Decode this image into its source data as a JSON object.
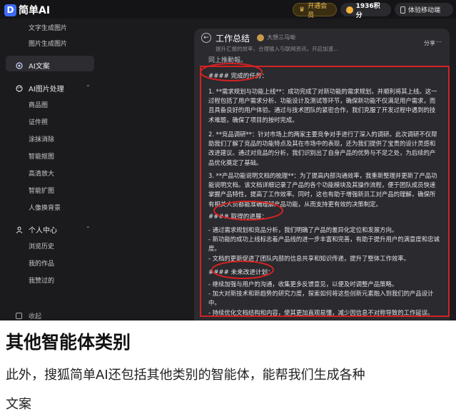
{
  "topbar": {
    "logo_mark": "D",
    "logo_text": "简单AI",
    "vip_label": "开通会员",
    "points_label": "1936积分",
    "mobile_label": "体验移动端"
  },
  "sidebar": {
    "items_top": [
      "文字生成图片",
      "图片生成图片"
    ],
    "active_label": "AI文案",
    "section_image": "AI图片处理",
    "image_items": [
      "商品图",
      "证件照",
      "涂抹消除",
      "智能抠图",
      "高清放大",
      "智能扩图",
      "人像换背景"
    ],
    "section_user": "个人中心",
    "user_items": [
      "浏览历史",
      "我的作品",
      "我赞过的"
    ],
    "collapse_label": "收起"
  },
  "panel": {
    "title": "工作总结",
    "author": "大想三马呦",
    "subtitle": "提升汇报的效率，合理输入与联网资讯，开启加速...",
    "share_label": "分享",
    "scroll_fragment": "同上推動報。",
    "h1": "#### 完成的任务：",
    "p1": "1. **需求规划与功能上线**：成功完成了对新功能的需求规划，并顺利将其上线。这一过程包括了用户需求分析、功能设计及测试等环节，确保新功能不仅满足用户需求，而且具备良好的用户体验。通过与技术团队的紧密合作，我们克服了开发过程中遇到的技术难题，确保了项目的按时完成。",
    "p2": "2. **竞品调研**：针对市场上的两家主要竞争对手进行了深入的调研。此次调研不仅帮助我们了解了竞品的功能特点及其在市场中的表现，还为我们提供了宝贵的设计灵感和改进建议。通过对竞品的分析，我们识别出了自身产品的优势与不足之处，为后续的产品优化奠定了基础。",
    "p3": "3. **产品功能说明文档的梳理**：为了提高内部沟通效率，我重新整理并更新了产品功能说明文档。该文档详细记录了产品的各个功能模块及其操作流程，便于团队成员快速掌握产品特性，提高了工作效率。同时，这也有助于增强新员工对产品的理解，确保所有相关人员都能准确理解产品功能，从而支持更有效的决策制定。",
    "h2": "#### 取得的进展：",
    "p4": "- 通过需求规划和竞品分析，我们明确了产品的差异化定位和发展方向。\n- 新功能的成功上线标志着产品线的进一步丰富和完善，有助于提升用户的满意度和忠诚度。\n- 文档的更新促进了团队内部的信息共享和知识传递，提升了整体工作效率。",
    "h3": "#### 未来改进计划：",
    "p5": "- 继续加强与用户的沟通，收集更多反馈意见，以便及时调整产品策略。\n- 加大对新技术和新趋势的研究力度，探索如何将这些创新元素融入到我们的产品设计中。\n- 持续优化文档结构和内容，使其更加直观易懂，减少因信息不对称导致的工作延误。"
  },
  "article": {
    "heading": "其他智能体类别",
    "line1": "此外，搜狐简单AI还包括其他类别的智能体，能帮我们生成各种",
    "line2": "文案"
  },
  "colors": {
    "annotation_red": "#d32222",
    "accent_blue": "#3d6cf5",
    "vip_gold": "#f2c15b"
  }
}
